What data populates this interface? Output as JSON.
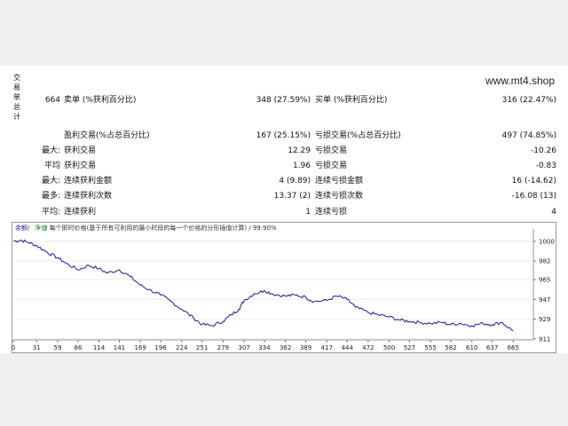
{
  "site": "www.mt4.shop",
  "side_label": "交易单总计",
  "stats": {
    "total_trades": "664",
    "short_label": "卖单 (%获利百分比)",
    "short_value": "348 (27.59%)",
    "long_label": "买单 (%获利百分比)",
    "long_value": "316 (22.47%)",
    "profit_trades_label": "盈利交易(%占总百分比)",
    "profit_trades_value": "167 (25.15%)",
    "loss_trades_label": "亏损交易(%占总百分比)",
    "loss_trades_value": "497 (74.85%)",
    "largest_label": "最大:",
    "largest_profit_label": "获利交易",
    "largest_profit_value": "12.29",
    "largest_loss_label": "亏损交易",
    "largest_loss_value": "-10.26",
    "average_label": "平均",
    "average_profit_label": "获利交易",
    "average_profit_value": "1.96",
    "average_loss_label": "亏损交易",
    "average_loss_value": "-0.83",
    "max_label": "最大:",
    "max_consec_wins_label": "连续获利金额",
    "max_consec_wins_value": "4 (9.89)",
    "max_consec_losses_label": "连续亏损金额",
    "max_consec_losses_value": "16 (-14.62)",
    "maximal_label": "最多:",
    "maximal_consec_profit_label": "连续获利次数",
    "maximal_consec_profit_value": "13.37 (2)",
    "maximal_consec_loss_label": "连续亏损次数",
    "maximal_consec_loss_value": "-16.08 (13)",
    "avg_consec_label": "平均:",
    "avg_consec_wins_label": "连续获利",
    "avg_consec_wins_value": "1",
    "avg_consec_losses_label": "连续亏损",
    "avg_consec_losses_value": "4"
  },
  "chart_data": {
    "type": "line",
    "legend_balance": "余额",
    "legend_divider": " / ",
    "legend_equity": "净值",
    "legend_desc": " / 每个即时价格(基于所有可利用的最小时段的每一个价格的分形插值计算) / 99.90%",
    "xlim": [
      0,
      680
    ],
    "ylim": [
      910,
      1008
    ],
    "x_ticks": [
      0,
      31,
      59,
      86,
      114,
      141,
      169,
      196,
      224,
      251,
      279,
      307,
      334,
      362,
      389,
      417,
      444,
      472,
      500,
      527,
      555,
      582,
      610,
      637,
      665
    ],
    "y_ticks": [
      911,
      929,
      947,
      965,
      982,
      1000
    ],
    "series": [
      {
        "color": "#1a1a8c",
        "x": [
          0,
          10,
          20,
          31,
          45,
          59,
          70,
          86,
          100,
          114,
          125,
          141,
          155,
          169,
          180,
          196,
          210,
          224,
          240,
          251,
          265,
          279,
          290,
          300,
          307,
          320,
          334,
          345,
          362,
          375,
          389,
          400,
          417,
          430,
          444,
          455,
          472,
          485,
          500,
          515,
          527,
          540,
          555,
          570,
          582,
          595,
          610,
          625,
          637,
          650,
          665
        ],
        "y": [
          1000,
          1001,
          999,
          996,
          990,
          985,
          980,
          974,
          978,
          975,
          971,
          974,
          968,
          960,
          956,
          951,
          945,
          938,
          930,
          924,
          923,
          927,
          933,
          938,
          946,
          952,
          955,
          952,
          950,
          951,
          949,
          945,
          946,
          950,
          947,
          940,
          935,
          933,
          931,
          928,
          927,
          926,
          925,
          926,
          924,
          925,
          923,
          925,
          924,
          926,
          918
        ]
      }
    ]
  }
}
